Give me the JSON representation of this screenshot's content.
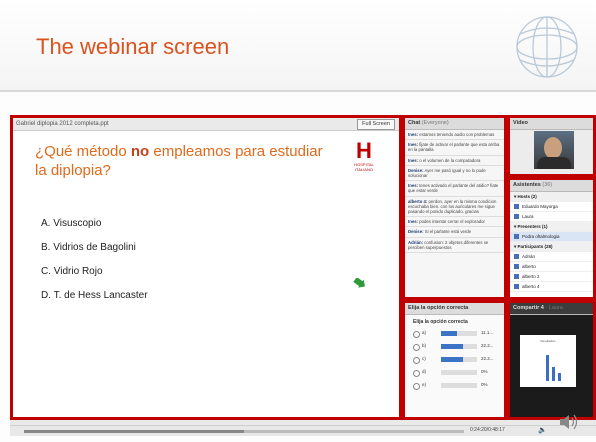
{
  "slide": {
    "title": "The webinar screen"
  },
  "presentation": {
    "file": "Gabriel diplopia 2012 completa.ppt",
    "fullscreen_label": "Full Screen",
    "question_pre": "¿Qué método ",
    "question_bold": "no",
    "question_post": " empleamos para estudiar la diplopia?",
    "logo_letter": "H",
    "logo_text": "HOSPITAL ITALIANO",
    "options": [
      "A.  Visuscopio",
      "B.  Vidrios de Bagolini",
      "C.  Vidrio Rojo",
      "D.  T. de Hess Lancaster"
    ]
  },
  "chat": {
    "title": "Chat",
    "subtitle": "(Everyone)",
    "messages": [
      {
        "author": "Ines:",
        "text": "estamos teniendo audio con problemas"
      },
      {
        "author": "Ines:",
        "text": "fijate de activar el parlante que esta arriba en la pantalla"
      },
      {
        "author": "Ines:",
        "text": "o el volumen de la computadora"
      },
      {
        "author": "Denise:",
        "text": "Ayer me pasó igual y no lo pude solucionar"
      },
      {
        "author": "Ines:",
        "text": "tenes activado el parlante del atidio? fiate que estar verde"
      },
      {
        "author": "alberto 4:",
        "text": "perdon, ayer en la misma condicion escuchaba bien. con los auriculares me sigue pasando el ponido duplicado. gracias"
      },
      {
        "author": "Ines:",
        "text": "podes intentar cerrar el explorador"
      },
      {
        "author": "Denise:",
        "text": "Si el parlante está verde"
      },
      {
        "author": "Adrián:",
        "text": "confusion: 2 objetos diferentes se perciben superpuestos"
      }
    ]
  },
  "video": {
    "title": "Video"
  },
  "attendees": {
    "title": "Asistentes",
    "count": "(36)",
    "rows": [
      {
        "label": "Hosts (2)",
        "kind": "grp"
      },
      {
        "label": "Eduardo Mayorga",
        "kind": "item"
      },
      {
        "label": "Laura",
        "kind": "item"
      },
      {
        "label": "Presenters (1)",
        "kind": "grp"
      },
      {
        "label": "Podra oftalmologia",
        "kind": "sel"
      },
      {
        "label": "Participants (28)",
        "kind": "grp"
      },
      {
        "label": "Adrián",
        "kind": "item"
      },
      {
        "label": "alberto",
        "kind": "item"
      },
      {
        "label": "alberto 2",
        "kind": "item"
      },
      {
        "label": "alberto 4",
        "kind": "item"
      }
    ]
  },
  "poll": {
    "title": "Elija la opción correcta",
    "question": "Elija la opción correcta",
    "rows": [
      {
        "label": "a)",
        "value": "11.1...",
        "fraction": 0.45
      },
      {
        "label": "b)",
        "value": "22.2...",
        "fraction": 0.6
      },
      {
        "label": "c)",
        "value": "22.2...",
        "fraction": 0.6
      },
      {
        "label": "d)",
        "value": "0%",
        "fraction": 0
      },
      {
        "label": "e)",
        "value": "0%",
        "fraction": 0
      }
    ]
  },
  "share": {
    "title": "Compartir 4",
    "subtitle": "- Laura",
    "doc_title": "Resultados"
  },
  "timeline": {
    "time": "0:24:20/0:48:17",
    "progress": 0.5
  },
  "colors": {
    "accent_red": "#c00000",
    "title_orange": "#d9531e",
    "bar_blue": "#3b73c6"
  }
}
